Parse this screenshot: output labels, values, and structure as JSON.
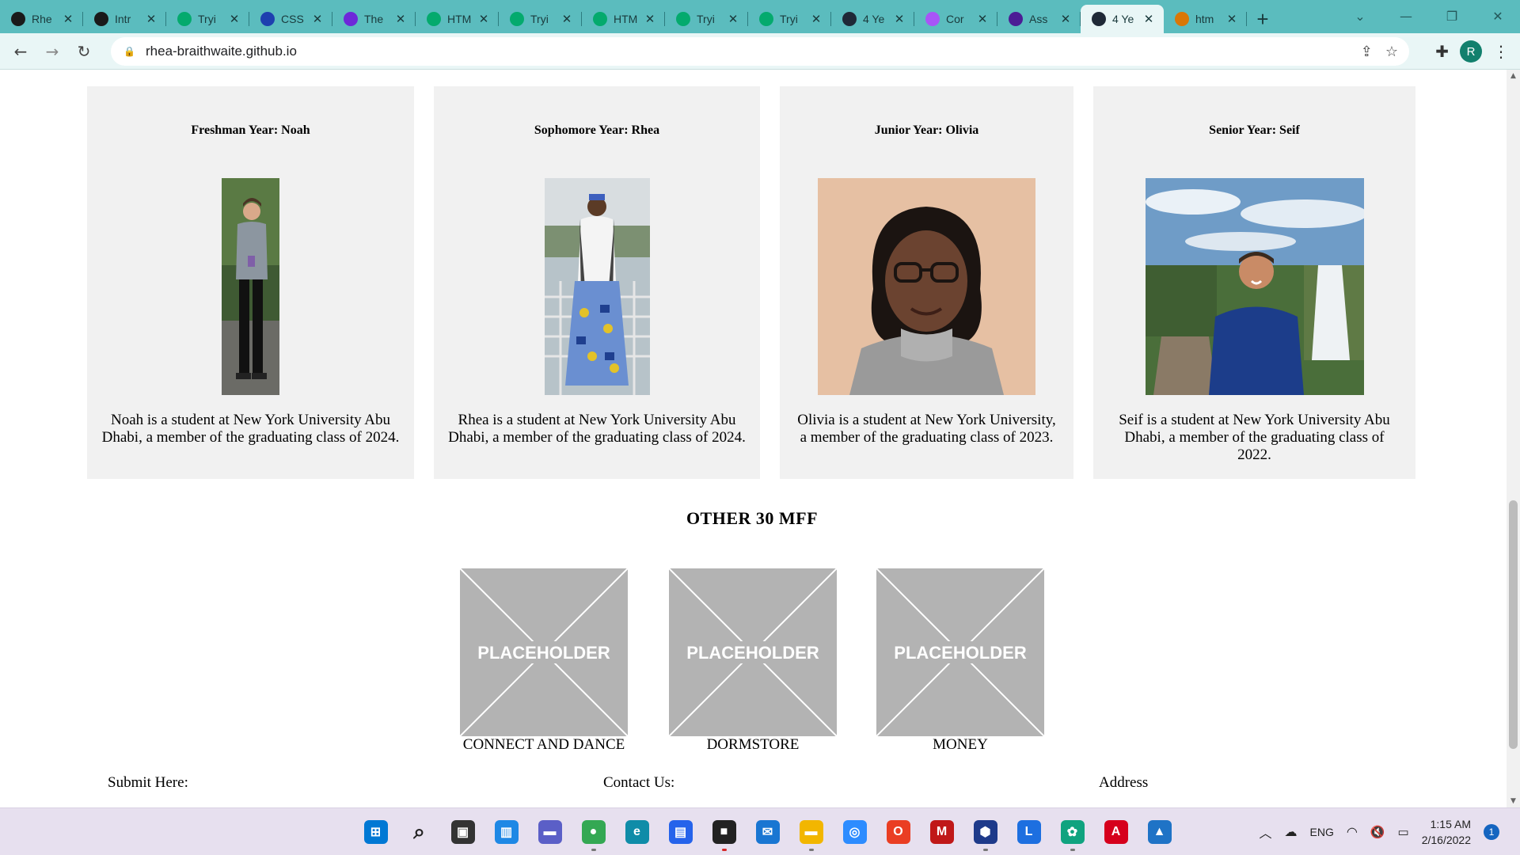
{
  "browser": {
    "tabs": [
      {
        "title": "Rhe",
        "favicon": "github-icon",
        "color": "#1a1a1a"
      },
      {
        "title": "Intr",
        "favicon": "github-icon",
        "color": "#1a1a1a"
      },
      {
        "title": "Tryi",
        "favicon": "w3schools-icon",
        "color": "#04aa6d"
      },
      {
        "title": "CSS",
        "favicon": "css-icon",
        "color": "#1e40af"
      },
      {
        "title": "The",
        "favicon": "h-icon",
        "color": "#6d28d9"
      },
      {
        "title": "HTM",
        "favicon": "w3schools-icon",
        "color": "#04aa6d"
      },
      {
        "title": "Tryi",
        "favicon": "w3schools-icon",
        "color": "#04aa6d"
      },
      {
        "title": "HTM",
        "favicon": "w3schools-icon",
        "color": "#04aa6d"
      },
      {
        "title": "Tryi",
        "favicon": "w3schools-icon",
        "color": "#04aa6d"
      },
      {
        "title": "Tryi",
        "favicon": "w3schools-icon",
        "color": "#04aa6d"
      },
      {
        "title": "4 Ye",
        "favicon": "globe-icon",
        "color": "#1f2937"
      },
      {
        "title": "Cor",
        "favicon": "cl-icon",
        "color": "#a855f7"
      },
      {
        "title": "Ass",
        "favicon": "assignment-icon",
        "color": "#4c1d95"
      },
      {
        "title": "4 Ye",
        "favicon": "globe-icon",
        "color": "#1f2937",
        "active": true
      },
      {
        "title": "htm",
        "favicon": "doc-icon",
        "color": "#d97706"
      }
    ],
    "new_tab_label": "+",
    "url": "rhea-braithwaite.github.io",
    "profile_initial": "R"
  },
  "students": [
    {
      "heading": "Freshman Year: Noah",
      "desc": "Noah is a student at New York University Abu Dhabi, a member of the graduating class of 2024.",
      "photo_bg": "#4a5a3a"
    },
    {
      "heading": "Sophomore Year: Rhea",
      "desc": "Rhea is a student at New York University Abu Dhabi, a member of the graduating class of 2024.",
      "photo_bg": "#8a9aa3"
    },
    {
      "heading": "Junior Year: Olivia",
      "desc": "Olivia is a student at New York University, a member of the graduating class of 2023.",
      "photo_bg": "#e7c3a7"
    },
    {
      "heading": "Senior Year: Seif",
      "desc": "Seif is a student at New York University Abu Dhabi, a member of the graduating class of 2022.",
      "photo_bg": "#5d7f9e"
    }
  ],
  "other_section": {
    "title": "OTHER 30 MFF",
    "items": [
      {
        "label": "CONNECT AND DANCE",
        "placeholder": "PLACEHOLDER"
      },
      {
        "label": "DORMSTORE",
        "placeholder": "PLACEHOLDER"
      },
      {
        "label": "MONEY",
        "placeholder": "PLACEHOLDER"
      }
    ]
  },
  "footer": {
    "submit": "Submit Here:",
    "contact": "Contact Us:",
    "address": "Address"
  },
  "taskbar": {
    "apps": [
      {
        "name": "start-icon",
        "color": "#0078d4",
        "glyph": "⊞"
      },
      {
        "name": "search-icon",
        "color": "#e7e0ef",
        "glyph": "⌕"
      },
      {
        "name": "task-view-icon",
        "color": "#333333",
        "glyph": "▣"
      },
      {
        "name": "widgets-icon",
        "color": "#1e88e5",
        "glyph": "▥"
      },
      {
        "name": "chat-icon",
        "color": "#5b5fc7",
        "glyph": "▬"
      },
      {
        "name": "chrome-icon",
        "color": "#34a853",
        "glyph": "●"
      },
      {
        "name": "edge-icon",
        "color": "#0f8ca8",
        "glyph": "e"
      },
      {
        "name": "store-icon",
        "color": "#2563eb",
        "glyph": "▤"
      },
      {
        "name": "sticky-notes-icon",
        "color": "#222222",
        "glyph": "■"
      },
      {
        "name": "mail-icon",
        "color": "#1976d2",
        "glyph": "✉"
      },
      {
        "name": "file-explorer-icon",
        "color": "#f2b600",
        "glyph": "▬"
      },
      {
        "name": "zoom-icon",
        "color": "#2d8cff",
        "glyph": "◎"
      },
      {
        "name": "office-icon",
        "color": "#ea3e23",
        "glyph": "O"
      },
      {
        "name": "mcafee-icon",
        "color": "#c01818",
        "glyph": "M"
      },
      {
        "name": "virtualbox-icon",
        "color": "#1e3a8a",
        "glyph": "⬢"
      },
      {
        "name": "l-app-icon",
        "color": "#1d6fe0",
        "glyph": "L"
      },
      {
        "name": "chatgpt-icon",
        "color": "#10a37f",
        "glyph": "✿"
      },
      {
        "name": "acrobat-icon",
        "color": "#d6001c",
        "glyph": "A"
      },
      {
        "name": "photos-icon",
        "color": "#1f73c6",
        "glyph": "▲"
      }
    ],
    "tray": {
      "lang": "ENG",
      "time": "1:15 AM",
      "date": "2/16/2022",
      "notifications": "1"
    }
  }
}
